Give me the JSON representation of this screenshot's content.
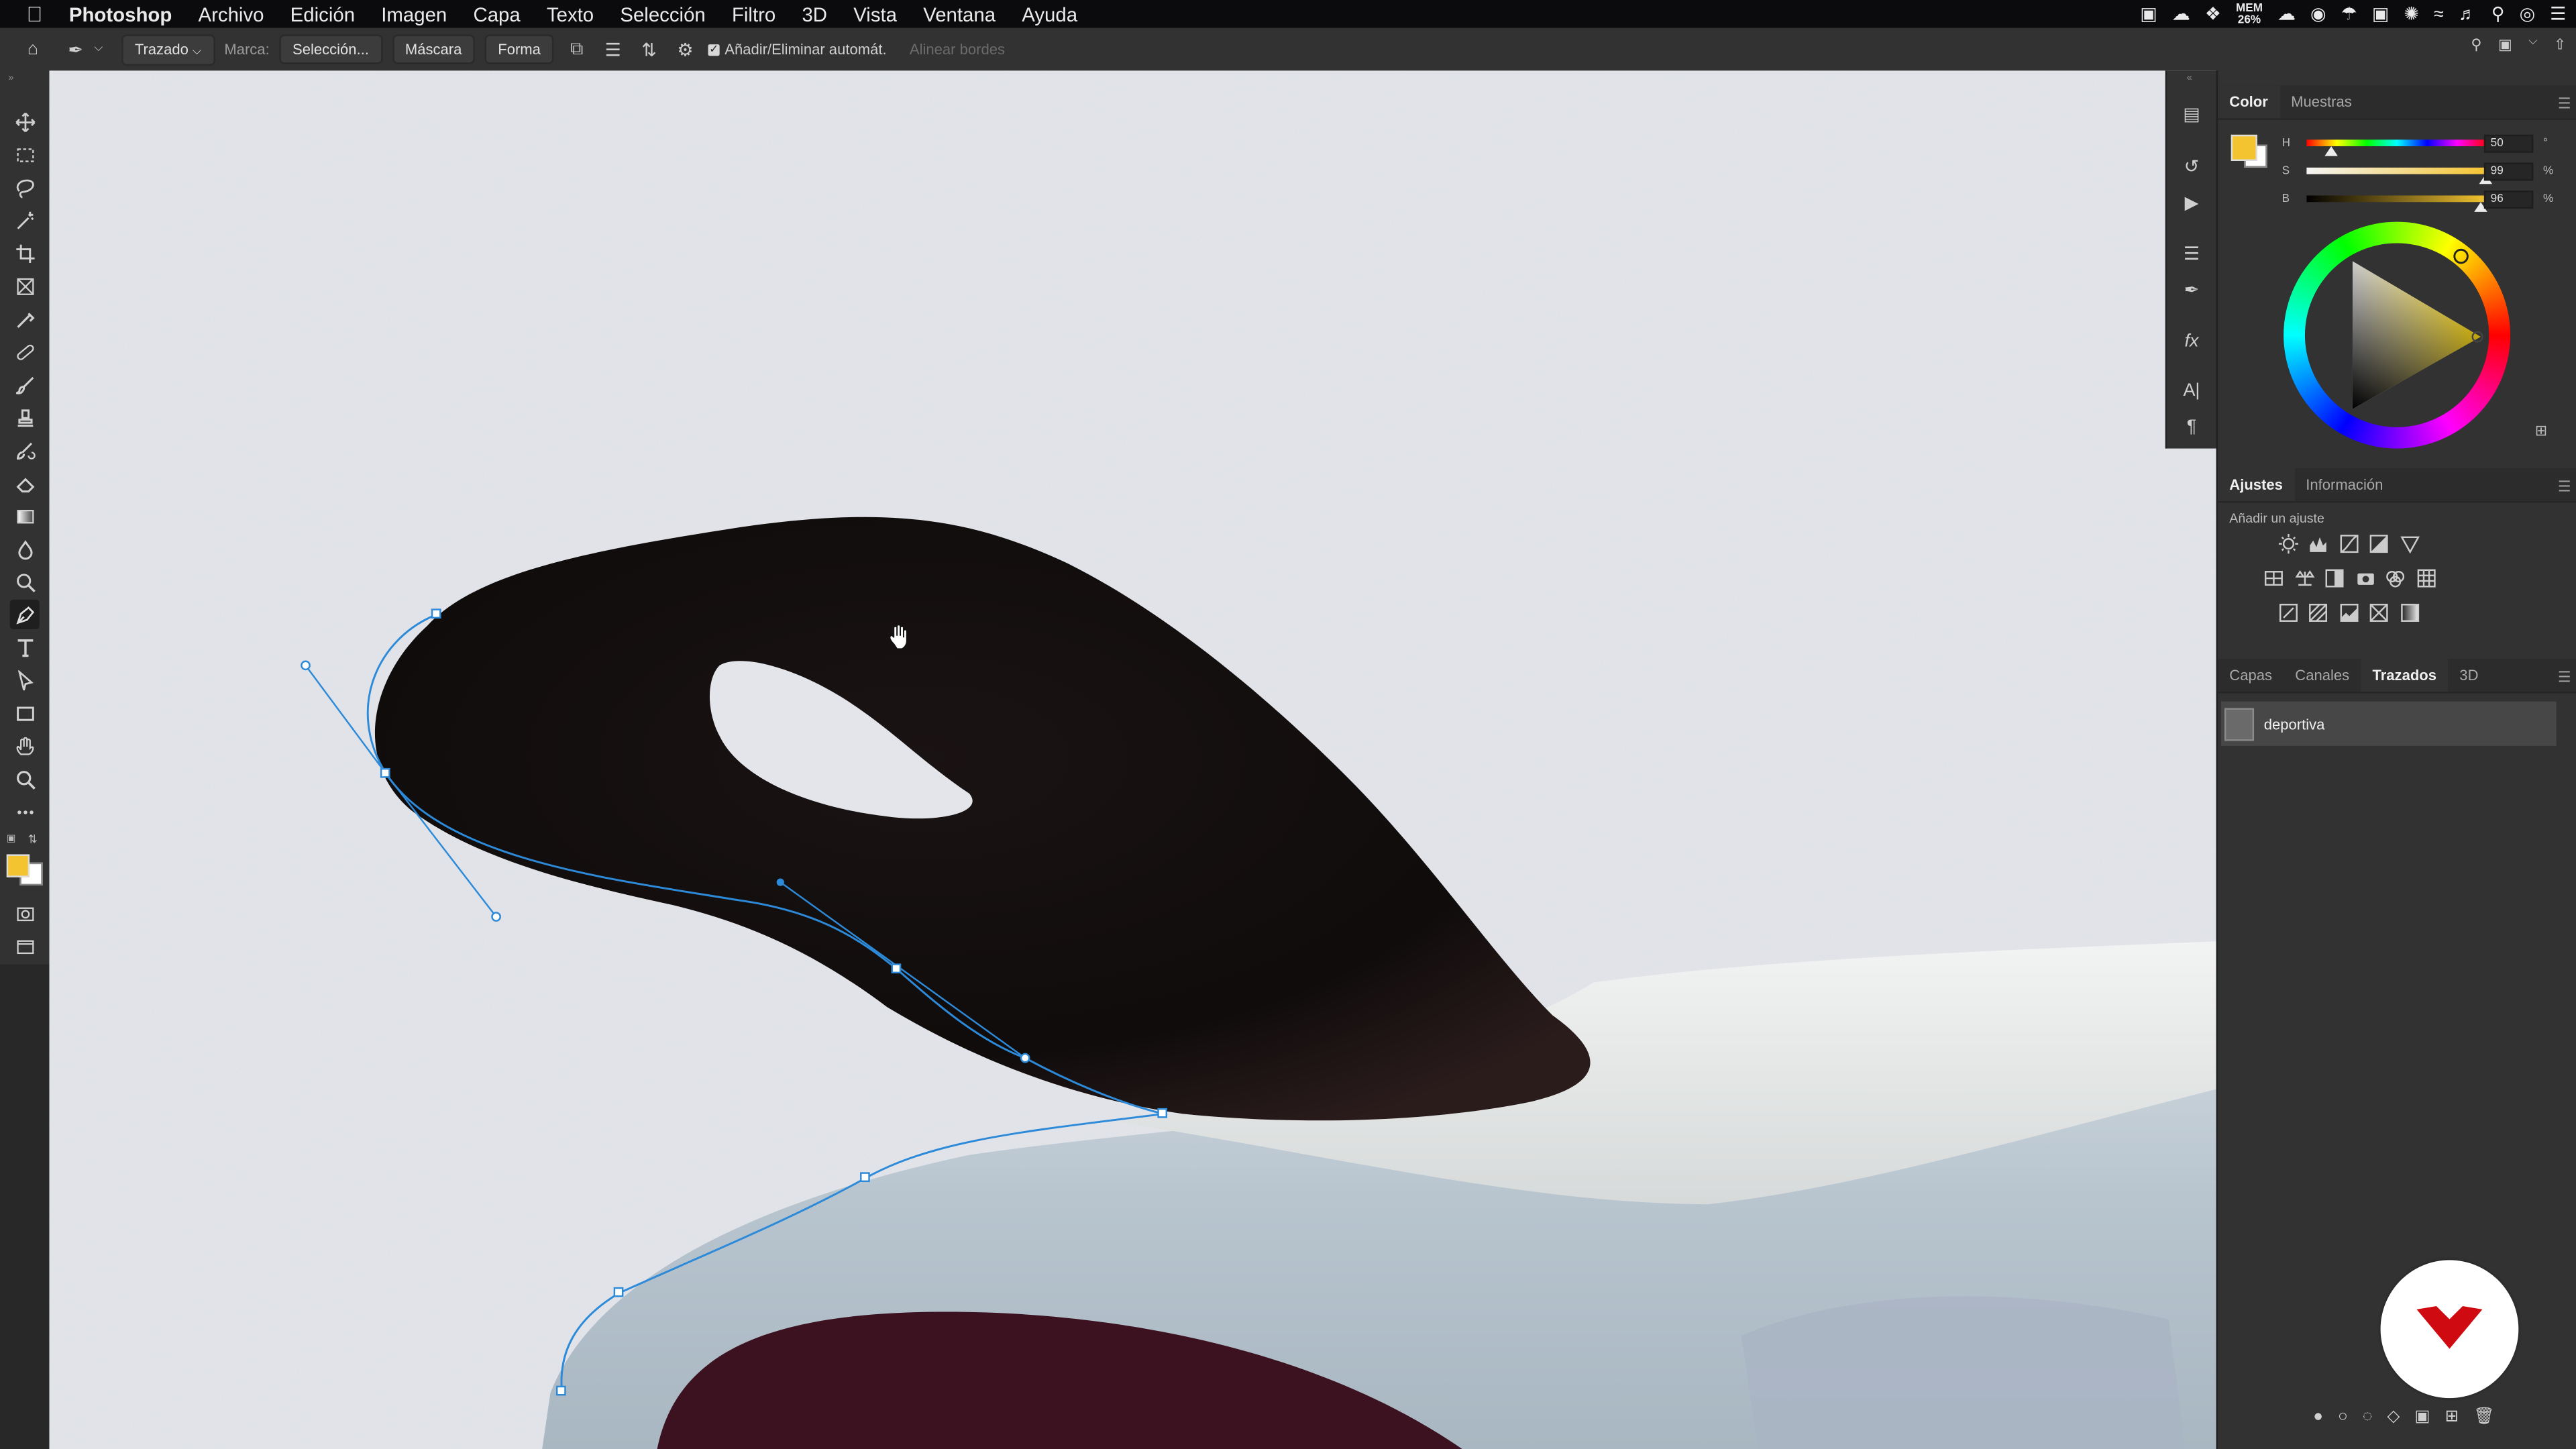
{
  "menubar": {
    "app": "Photoshop",
    "items": [
      "Archivo",
      "Edición",
      "Imagen",
      "Capa",
      "Texto",
      "Selección",
      "Filtro",
      "3D",
      "Vista",
      "Ventana",
      "Ayuda"
    ],
    "memory_label": "MEM",
    "memory_value": "26%"
  },
  "options_bar": {
    "mode": "Trazado",
    "mark_label": "Marca:",
    "selection_button": "Selección...",
    "mask_button": "Máscara",
    "shape_button": "Forma",
    "auto_add_delete": "Añadir/Eliminar automát.",
    "align_edges": "Alinear bordes"
  },
  "color_panel": {
    "tabs": [
      "Color",
      "Muestras"
    ],
    "foreground": "#f4c430",
    "background": "#ffffff",
    "h_label": "H",
    "s_label": "S",
    "b_label": "B",
    "h_value": "50",
    "s_value": "99",
    "b_value": "96",
    "h_unit": "°",
    "s_unit": "%",
    "b_unit": "%",
    "h_fraction": 0.139,
    "s_fraction": 0.99,
    "b_fraction": 0.96
  },
  "adjustments_panel": {
    "tabs": [
      "Ajustes",
      "Información"
    ],
    "title": "Añadir un ajuste"
  },
  "layers_panel": {
    "tabs": [
      "Capas",
      "Canales",
      "Trazados",
      "3D"
    ],
    "path_name": "deportiva"
  },
  "colors": {
    "accent_path": "#2d8ad8",
    "chrome_dark": "#323232",
    "canvas_bg": "#e2e4e9",
    "logo_red": "#cf0a10"
  }
}
